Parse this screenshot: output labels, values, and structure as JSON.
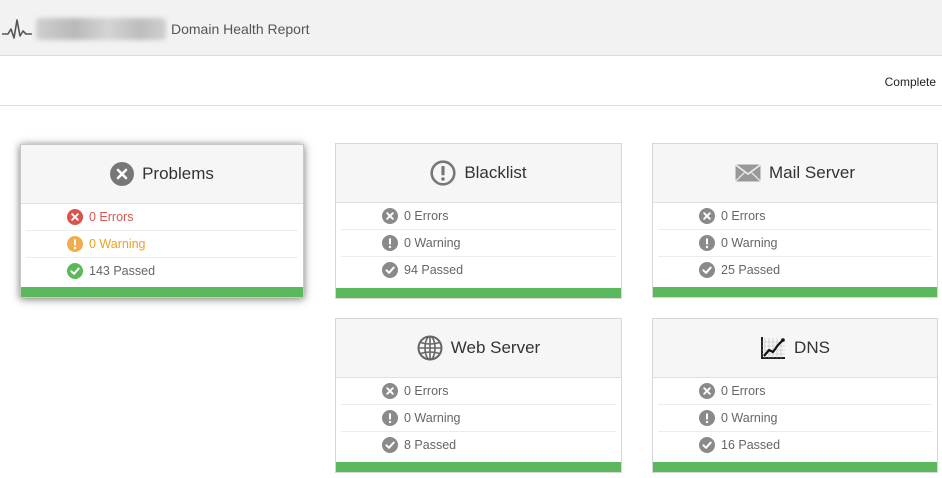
{
  "header": {
    "title": "Domain Health Report"
  },
  "status": {
    "text": "Complete"
  },
  "colors": {
    "error": "#d9534f",
    "warning": "#f0ad4e",
    "passed": "#5cb85c",
    "neutral": "#8a8a8a",
    "bar": "#5cb85c"
  },
  "cards": {
    "problems": {
      "title": "Problems",
      "icon": "x-circle-icon",
      "errors": "0 Errors",
      "warning": "0 Warning",
      "passed": "143 Passed"
    },
    "blacklist": {
      "title": "Blacklist",
      "icon": "exclamation-circle-icon",
      "errors": "0 Errors",
      "warning": "0 Warning",
      "passed": "94 Passed"
    },
    "mailserver": {
      "title": "Mail Server",
      "icon": "envelope-icon",
      "errors": "0 Errors",
      "warning": "0 Warning",
      "passed": "25 Passed"
    },
    "webserver": {
      "title": "Web Server",
      "icon": "globe-icon",
      "errors": "0 Errors",
      "warning": "0 Warning",
      "passed": "8 Passed"
    },
    "dns": {
      "title": "DNS",
      "icon": "chart-line-icon",
      "errors": "0 Errors",
      "warning": "0 Warning",
      "passed": "16 Passed"
    }
  }
}
